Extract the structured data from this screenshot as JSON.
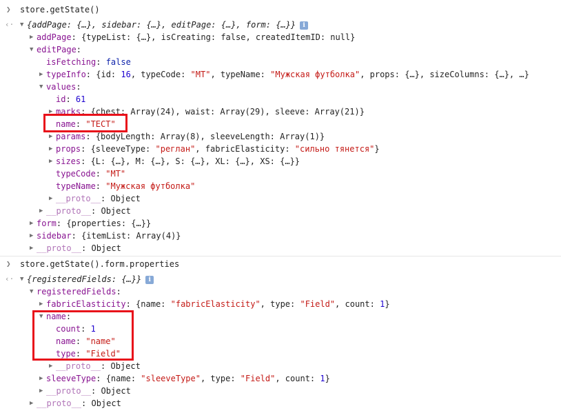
{
  "console": {
    "commands": [
      {
        "input": "store.getState()"
      },
      {
        "input": "store.getState().form.properties"
      }
    ],
    "tree1": {
      "root_preview": "{addPage: {…}, sidebar: {…}, editPage: {…}, form: {…}}",
      "addPage": {
        "key": "addPage",
        "preview": "{typeList: {…}, isCreating: false, createdItemID: null}"
      },
      "editPage": {
        "key": "editPage"
      },
      "isFetching": {
        "key": "isFetching",
        "value": "false"
      },
      "typeInfo": {
        "key": "typeInfo",
        "preview_pre": "{id: ",
        "id": "16",
        "preview_mid1": ", typeCode: ",
        "typeCode": "\"MT\"",
        "preview_mid2": ", typeName: ",
        "typeName": "\"Мужская футболка\"",
        "preview_post": ", props: {…}, sizeColumns: {…}, …}"
      },
      "values": {
        "key": "values"
      },
      "id": {
        "key": "id",
        "value": "61"
      },
      "marks": {
        "key": "marks",
        "preview": "{chest: Array(24), waist: Array(29), sleeve: Array(21)}"
      },
      "name": {
        "key": "name",
        "value": "\"ТЕСТ\""
      },
      "params": {
        "key": "params",
        "preview": "{bodyLength: Array(8), sleeveLength: Array(1)}"
      },
      "props": {
        "key": "props",
        "preview_pre": "{sleeveType: ",
        "sleeveType": "\"реглан\"",
        "preview_mid": ", fabricElasticity: ",
        "fabricElasticity": "\"сильно тянется\"",
        "preview_post": "}"
      },
      "sizes": {
        "key": "sizes",
        "preview": "{L: {…}, M: {…}, S: {…}, XL: {…}, XS: {…}}"
      },
      "typeCode": {
        "key": "typeCode",
        "value": "\"MT\""
      },
      "typeName": {
        "key": "typeName",
        "value": "\"Мужская футболка\""
      },
      "proto_values": {
        "key": "__proto__",
        "value": "Object"
      },
      "proto_editPage": {
        "key": "__proto__",
        "value": "Object"
      },
      "form": {
        "key": "form",
        "preview": "{properties: {…}}"
      },
      "sidebar": {
        "key": "sidebar",
        "preview": "{itemList: Array(4)}"
      },
      "proto_root": {
        "key": "__proto__",
        "value": "Object"
      }
    },
    "tree2": {
      "root_preview": "{registeredFields: {…}}",
      "registeredFields": {
        "key": "registeredFields"
      },
      "fabricElasticity": {
        "key": "fabricElasticity",
        "preview_pre": "{name: ",
        "name": "\"fabricElasticity\"",
        "preview_mid": ", type: ",
        "type": "\"Field\"",
        "preview_mid2": ", count: ",
        "count": "1",
        "preview_post": "}"
      },
      "name": {
        "key": "name"
      },
      "count": {
        "key": "count",
        "value": "1"
      },
      "name_inner": {
        "key": "name",
        "value": "\"name\""
      },
      "type": {
        "key": "type",
        "value": "\"Field\""
      },
      "proto_name": {
        "key": "__proto__",
        "value": "Object"
      },
      "sleeveType": {
        "key": "sleeveType",
        "preview_pre": "{name: ",
        "name": "\"sleeveType\"",
        "preview_mid": ", type: ",
        "type": "\"Field\"",
        "preview_mid2": ", count: ",
        "count": "1",
        "preview_post": "}"
      },
      "proto_registered": {
        "key": "__proto__",
        "value": "Object"
      },
      "proto_root": {
        "key": "__proto__",
        "value": "Object"
      }
    },
    "colors": {
      "highlight": "#e8101a",
      "key": "#881391",
      "string": "#c41a16",
      "number": "#1c00cf",
      "keyword": "#0d22aa"
    }
  }
}
